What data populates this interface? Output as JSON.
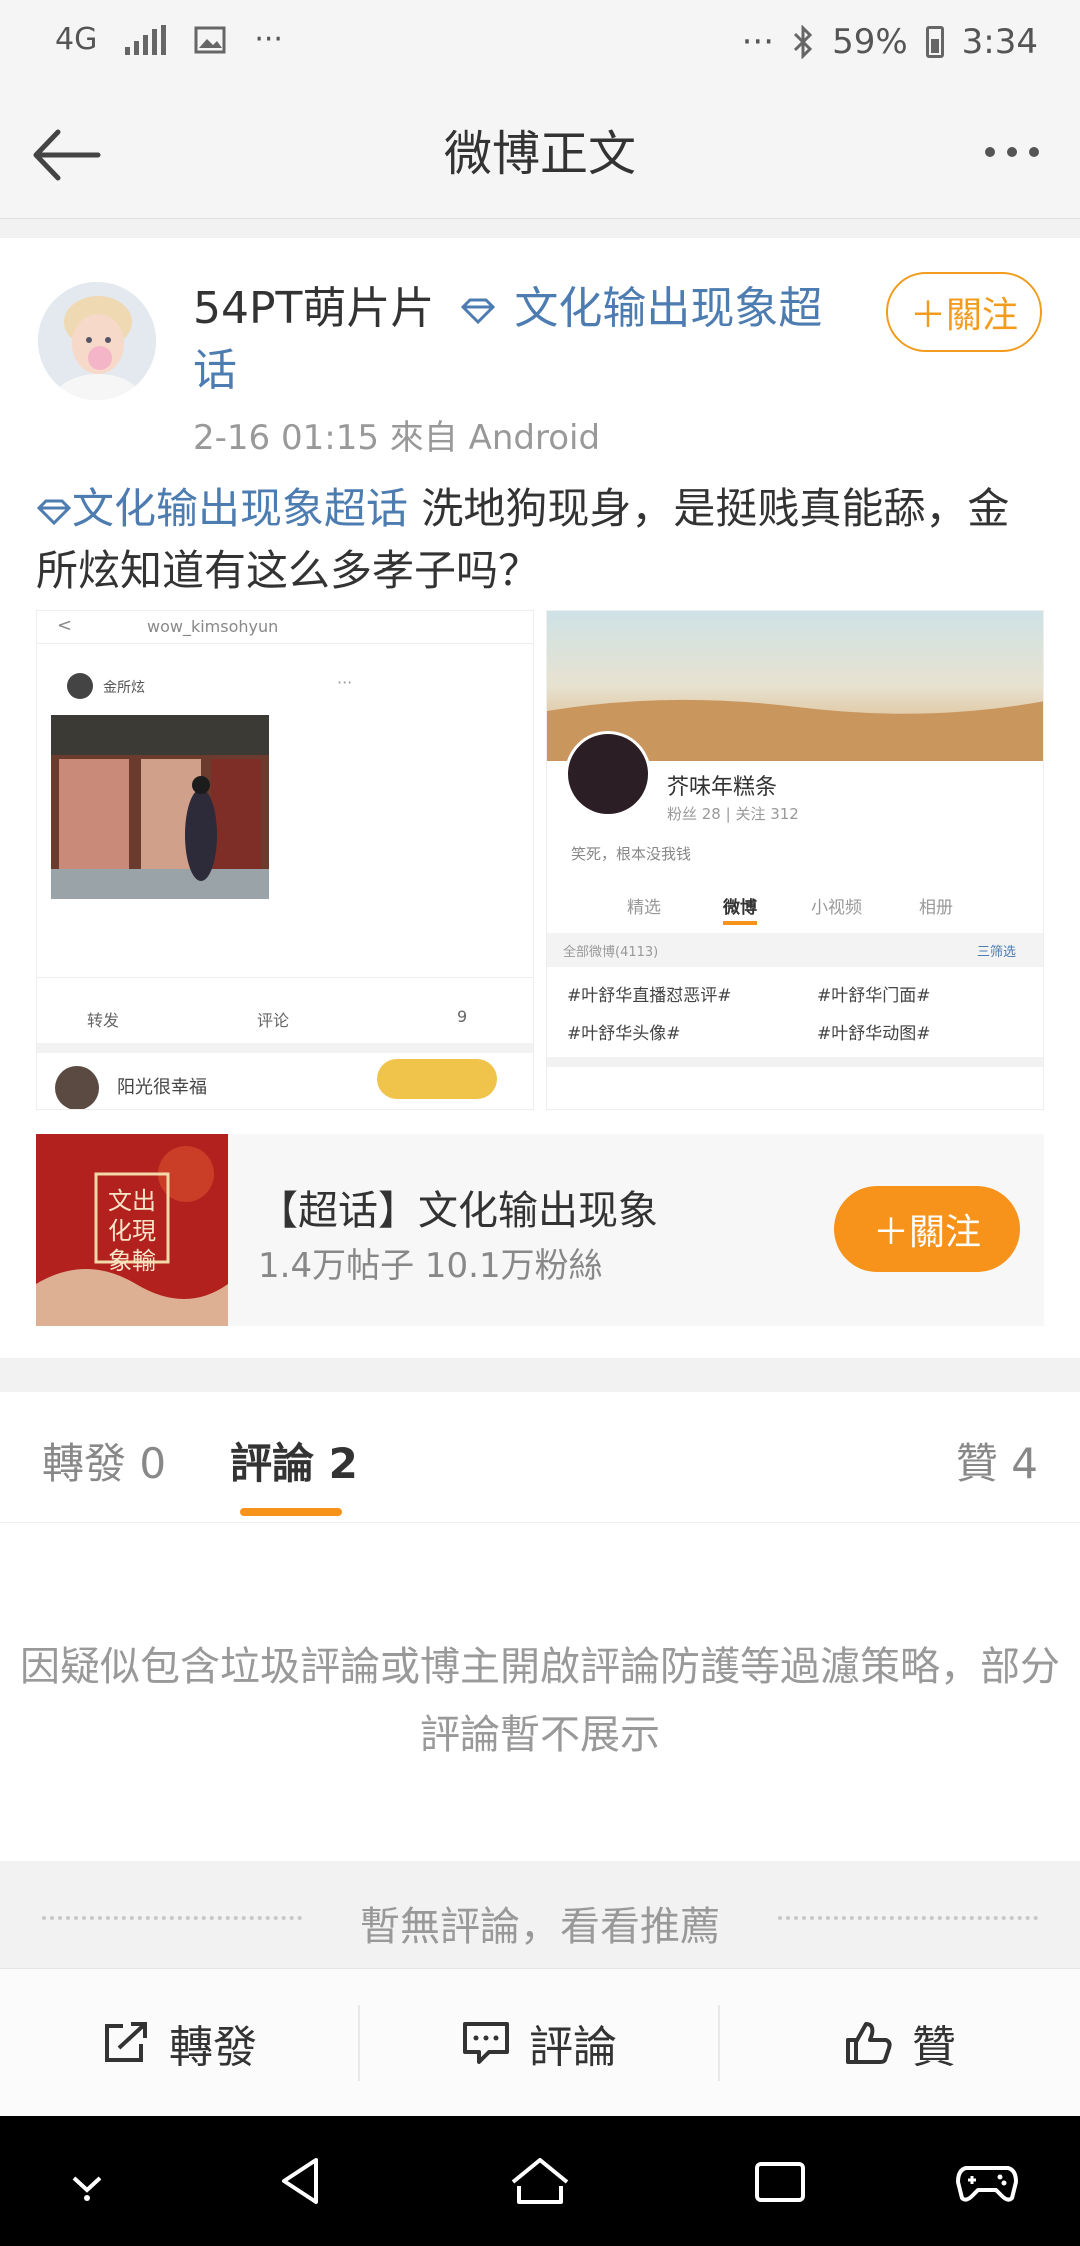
{
  "status_bar": {
    "network": "4G",
    "more_left": "···",
    "more_right": "···",
    "battery": "59%",
    "time": "3:34"
  },
  "header": {
    "title": "微博正文"
  },
  "post": {
    "username": "54PT萌片片",
    "topic_tag": "文化输出现象超话",
    "meta": "2-16 01:15  來自 Android",
    "follow_label": "＋關注",
    "text_topic": "文化输出现象超话",
    "text_body": " 洗地狗现身，是挺贱真能舔，金所炫知道有这么多孝子吗？",
    "image1": {
      "handle": "wow_kimsohyun",
      "post_name": "金所炫",
      "actions": [
        "转发",
        "评论",
        "9"
      ],
      "comment_user": "阳光很幸福"
    },
    "image2": {
      "name": "芥味年糕条",
      "stats": "粉丝 28 | 关注 312",
      "bio": "笑死，根本没我钱",
      "tabs": [
        "精选",
        "微博",
        "小视频",
        "相册"
      ],
      "filter_left": "全部微博(4113)",
      "filter_right": "三筛选",
      "tags": [
        "#叶舒华直播怼恶评#",
        "#叶舒华门面#",
        "#叶舒华头像#",
        "#叶舒华动图#"
      ]
    }
  },
  "topic_card": {
    "thumb_text": "文出化現象輸",
    "name": "【超话】文化输出现象",
    "stats": "1.4万帖子 10.1万粉絲",
    "follow_label": "＋關注"
  },
  "tabs": {
    "repost": "轉發 0",
    "comment": "評論 2",
    "like": "贊 4"
  },
  "notice": "因疑似包含垃圾評論或博主開啟評論防護等過濾策略，部分評論暫不展示",
  "recommend": "暫無評論，看看推薦",
  "actions": {
    "repost": "轉發",
    "comment": "評論",
    "like": "贊"
  }
}
